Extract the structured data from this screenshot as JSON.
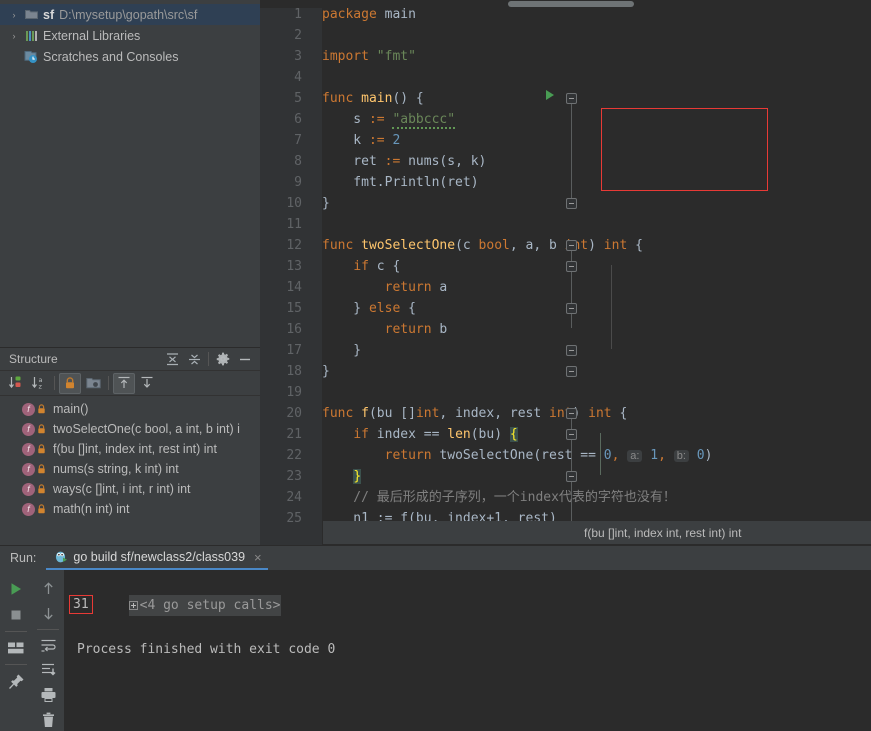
{
  "project_tree": {
    "items": [
      {
        "arrow": "›",
        "icon": "folder-icon",
        "name": "sf",
        "path": "D:\\mysetup\\gopath\\src\\sf",
        "selected": true
      },
      {
        "arrow": "›",
        "icon": "libraries-icon",
        "name": "External Libraries",
        "path": "",
        "selected": false
      },
      {
        "arrow": "",
        "icon": "scratches-icon",
        "name": "Scratches and Consoles",
        "path": "",
        "selected": false
      }
    ]
  },
  "structure": {
    "title": "Structure",
    "header_buttons": [
      "expand-all-icon",
      "collapse-all-icon",
      "gear-icon",
      "minimize-icon"
    ],
    "toolbar_buttons": [
      "sort-by-visibility-icon",
      "sort-alphabetically-icon",
      "show-non-public-icon",
      "group-by-file-icon",
      "show-inherited-icon",
      "show-anonymous-icon"
    ],
    "items": [
      {
        "label": "main()"
      },
      {
        "label": "twoSelectOne(c bool, a int, b int) i"
      },
      {
        "label": "f(bu []int, index int, rest int) int"
      },
      {
        "label": "nums(s string, k int) int"
      },
      {
        "label": "ways(c []int, i int, r int) int"
      },
      {
        "label": "math(n int) int"
      }
    ]
  },
  "editor": {
    "breadcrumb_tooltip": "f(bu []int, index int, rest int) int",
    "lines": [
      {
        "no": "1",
        "tokens": [
          {
            "t": "package ",
            "c": "kw"
          },
          {
            "t": "main",
            "c": "id"
          }
        ],
        "indent": 0
      },
      {
        "no": "2",
        "tokens": [],
        "indent": 0
      },
      {
        "no": "3",
        "tokens": [
          {
            "t": "import ",
            "c": "kw"
          },
          {
            "t": "\"fmt\"",
            "c": "str"
          }
        ],
        "indent": 0
      },
      {
        "no": "4",
        "tokens": [],
        "indent": 0
      },
      {
        "no": "5",
        "tokens": [
          {
            "t": "func ",
            "c": "kw"
          },
          {
            "t": "main",
            "c": "fn"
          },
          {
            "t": "() {",
            "c": "id"
          }
        ],
        "indent": 0
      },
      {
        "no": "6",
        "tokens": [
          {
            "t": "    s ",
            "c": "id"
          },
          {
            "t": ":=",
            "c": "kw"
          },
          {
            "t": " ",
            "c": "id"
          },
          {
            "t": "\"abbccc\"",
            "c": "str squig"
          }
        ],
        "indent": 1
      },
      {
        "no": "7",
        "tokens": [
          {
            "t": "    k ",
            "c": "id"
          },
          {
            "t": ":=",
            "c": "kw"
          },
          {
            "t": " ",
            "c": "id"
          },
          {
            "t": "2",
            "c": "num"
          }
        ],
        "indent": 1
      },
      {
        "no": "8",
        "tokens": [
          {
            "t": "    ret ",
            "c": "id"
          },
          {
            "t": ":=",
            "c": "kw"
          },
          {
            "t": " nums(s, k)",
            "c": "id"
          }
        ],
        "indent": 1
      },
      {
        "no": "9",
        "tokens": [
          {
            "t": "    fmt.Println(ret)",
            "c": "id"
          }
        ],
        "indent": 1
      },
      {
        "no": "10",
        "tokens": [
          {
            "t": "}",
            "c": "id"
          }
        ],
        "indent": 0
      },
      {
        "no": "11",
        "tokens": [],
        "indent": 0
      },
      {
        "no": "12",
        "tokens": [
          {
            "t": "func ",
            "c": "kw"
          },
          {
            "t": "twoSelectOne",
            "c": "fn"
          },
          {
            "t": "(c ",
            "c": "id"
          },
          {
            "t": "bool",
            "c": "typ"
          },
          {
            "t": ", a, b ",
            "c": "id"
          },
          {
            "t": "int",
            "c": "typ"
          },
          {
            "t": ") ",
            "c": "id"
          },
          {
            "t": "int",
            "c": "typ"
          },
          {
            "t": " {",
            "c": "id"
          }
        ],
        "indent": 0
      },
      {
        "no": "13",
        "tokens": [
          {
            "t": "    ",
            "c": "id"
          },
          {
            "t": "if",
            "c": "kw"
          },
          {
            "t": " c {",
            "c": "id"
          }
        ],
        "indent": 1
      },
      {
        "no": "14",
        "tokens": [
          {
            "t": "        ",
            "c": "id"
          },
          {
            "t": "return",
            "c": "kw"
          },
          {
            "t": " a",
            "c": "id"
          }
        ],
        "indent": 2
      },
      {
        "no": "15",
        "tokens": [
          {
            "t": "    } ",
            "c": "id"
          },
          {
            "t": "else",
            "c": "kw"
          },
          {
            "t": " {",
            "c": "id"
          }
        ],
        "indent": 1
      },
      {
        "no": "16",
        "tokens": [
          {
            "t": "        ",
            "c": "id"
          },
          {
            "t": "return",
            "c": "kw"
          },
          {
            "t": " b",
            "c": "id"
          }
        ],
        "indent": 2
      },
      {
        "no": "17",
        "tokens": [
          {
            "t": "    }",
            "c": "id"
          }
        ],
        "indent": 1
      },
      {
        "no": "18",
        "tokens": [
          {
            "t": "}",
            "c": "id"
          }
        ],
        "indent": 0
      },
      {
        "no": "19",
        "tokens": [],
        "indent": 0
      },
      {
        "no": "20",
        "tokens": [
          {
            "t": "func ",
            "c": "kw"
          },
          {
            "t": "f",
            "c": "fn"
          },
          {
            "t": "(bu []",
            "c": "id"
          },
          {
            "t": "int",
            "c": "typ"
          },
          {
            "t": ", index, rest ",
            "c": "id"
          },
          {
            "t": "int",
            "c": "typ"
          },
          {
            "t": ") ",
            "c": "id"
          },
          {
            "t": "int",
            "c": "typ"
          },
          {
            "t": " {",
            "c": "id"
          }
        ],
        "indent": 0
      },
      {
        "no": "21",
        "tokens": [
          {
            "t": "    ",
            "c": "id"
          },
          {
            "t": "if",
            "c": "kw"
          },
          {
            "t": " index == ",
            "c": "id"
          },
          {
            "t": "len",
            "c": "fn"
          },
          {
            "t": "(bu) ",
            "c": "id"
          },
          {
            "t": "{",
            "c": "brc-hl"
          }
        ],
        "indent": 1
      },
      {
        "no": "22",
        "tokens": [
          {
            "t": "        ",
            "c": "id"
          },
          {
            "t": "return",
            "c": "kw"
          },
          {
            "t": " twoSelectOne(rest == ",
            "c": "id"
          },
          {
            "t": "0",
            "c": "num"
          },
          {
            "t": ", ",
            "c": "kw"
          },
          {
            "t": "a:",
            "c": "hint"
          },
          {
            "t": " ",
            "c": "id"
          },
          {
            "t": "1",
            "c": "num"
          },
          {
            "t": ",",
            "c": "kw"
          },
          {
            "t": " ",
            "c": "id"
          },
          {
            "t": "b:",
            "c": "hint"
          },
          {
            "t": " ",
            "c": "id"
          },
          {
            "t": "0",
            "c": "num"
          },
          {
            "t": ")",
            "c": "id"
          }
        ],
        "indent": 2
      },
      {
        "no": "23",
        "tokens": [
          {
            "t": "    ",
            "c": "id"
          },
          {
            "t": "}",
            "c": "brc-hl"
          }
        ],
        "indent": 1
      },
      {
        "no": "24",
        "tokens": [
          {
            "t": "    // 最后形成的子序列，一个index代表的字符也没有！",
            "c": "cmt"
          }
        ],
        "indent": 1
      },
      {
        "no": "25",
        "tokens": [
          {
            "t": "    n1 := f(bu, index+1, rest)",
            "c": "id"
          }
        ],
        "indent": 1
      }
    ]
  },
  "run_panel": {
    "run_label": "Run:",
    "tab_label": "go build sf/newclass2/class039",
    "tab_close": "×",
    "left_buttons": [
      "run-icon",
      "stop-icon",
      "layout-icon",
      "pin-icon"
    ],
    "right_buttons": [
      "up-arrow-icon",
      "down-arrow-icon",
      "soft-wrap-icon",
      "scroll-to-end-icon",
      "print-icon",
      "trash-icon"
    ],
    "console": {
      "setup_line": "<4 go setup calls>",
      "output_value": "31",
      "process_line": "Process finished with exit code 0"
    }
  },
  "colors": {
    "editor_bg": "#2b2b2b",
    "panel_bg": "#3c3f41",
    "gutter_bg": "#313335",
    "selection_blue": "#2f4054",
    "accent_blue": "#4a88c7",
    "highlight_red": "#e83a36",
    "keyword_orange": "#cc7832",
    "string_green": "#6a8759",
    "number_blue": "#6897bb",
    "function_yellow": "#ffc66d",
    "identifier": "#a9b7c6",
    "comment_gray": "#808080",
    "run_green": "#499c54"
  }
}
